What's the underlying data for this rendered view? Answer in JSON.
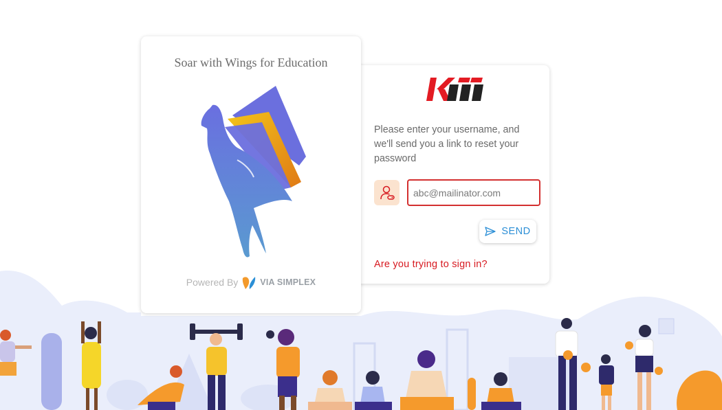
{
  "brand": {
    "tagline": "Soar with Wings for Education",
    "powered_by": "Powered By",
    "vendor": "VIA SIMPLEX",
    "logo_icon": "winged-woman-book-icon"
  },
  "form": {
    "logo": "KII",
    "instruction": "Please enter your username, and we'll send you a link to reset your password",
    "user_icon": "user-icon",
    "email_value": "abc@mailinator.com",
    "send_label": "SEND",
    "send_icon": "paper-plane-icon",
    "signin_link": "Are you trying to sign in?"
  },
  "colors": {
    "accent_red": "#d71920",
    "send_blue": "#2c8fd6",
    "illustration_bg": "#e9edfb"
  }
}
